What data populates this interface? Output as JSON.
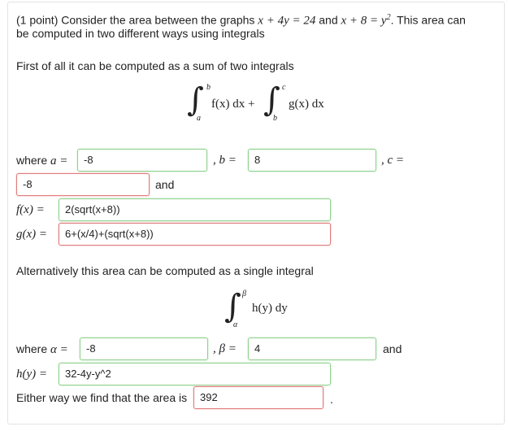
{
  "intro": {
    "prefix": "(1 point) Consider the area between the graphs",
    "eq1": "x + 4y = 24",
    "and": "and",
    "eq2": "x + 8 = y",
    "eq2_exp": "2",
    "suffix": ". This area can",
    "line2": "be computed in two different ways using integrals"
  },
  "part1": {
    "heading": "First of all it can be computed as a sum of two integrals",
    "integral1": {
      "lower": "a",
      "upper": "b",
      "body": "f(x) dx +"
    },
    "integral2": {
      "lower": "b",
      "upper": "c",
      "body": "g(x) dx"
    },
    "where_label": "where",
    "a_label": "a =",
    "a_value": "-8",
    "b_label": ", b =",
    "b_value": "8",
    "c_label": ", c =",
    "c_value": "-8",
    "and_label": "and",
    "f_label": "f(x) =",
    "f_value": "2(sqrt(x+8))",
    "g_label": "g(x) =",
    "g_value": "6+(x/4)+(sqrt(x+8))"
  },
  "part2": {
    "heading": "Alternatively this area can be computed as a single integral",
    "integral": {
      "lower": "α",
      "upper": "β",
      "body": "h(y) dy"
    },
    "where_label": "where",
    "alpha_label": "α =",
    "alpha_value": "-8",
    "beta_label": ", β =",
    "beta_value": "4",
    "and_label": "and",
    "h_label": "h(y) =",
    "h_value": "32-4y-y^2",
    "area_text": "Either way we find that the area is",
    "area_value": "392",
    "period": "."
  },
  "status_colors": {
    "correct": "#8fd08f",
    "incorrect": "#e07b7b"
  }
}
